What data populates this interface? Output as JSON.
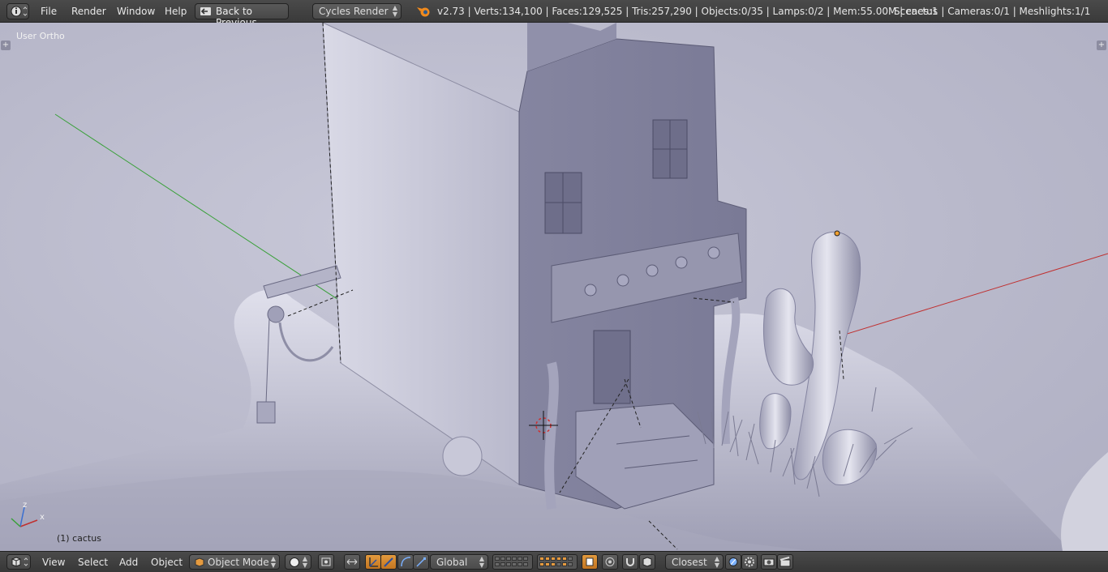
{
  "topbar": {
    "menu": [
      "File",
      "Render",
      "Window",
      "Help"
    ],
    "back_button": "Back to Previous",
    "render_engine": "Cycles Render",
    "stats": "v2.73 | Verts:134,100 | Faces:129,525 | Tris:257,290 | Objects:0/35 | Lamps:0/2 | Mem:55.00M | cactus",
    "scene_stats": "Scenes:1 | Cameras:0/1 | Meshlights:1/1"
  },
  "viewport": {
    "view_name": "User Ortho",
    "active_object": "(1) cactus",
    "axis_labels": {
      "x": "x",
      "z": "z"
    }
  },
  "bottombar": {
    "menu": [
      "View",
      "Select",
      "Add",
      "Object"
    ],
    "mode": "Object Mode",
    "orientation": "Global",
    "snap_target": "Closest"
  },
  "colors": {
    "header_bg": "#424242",
    "viewport_bg": "#b9b9cb",
    "accent": "#e59a3f",
    "x_axis": "#c03030",
    "y_axis": "#38a038",
    "z_axis": "#3a6fd0"
  }
}
